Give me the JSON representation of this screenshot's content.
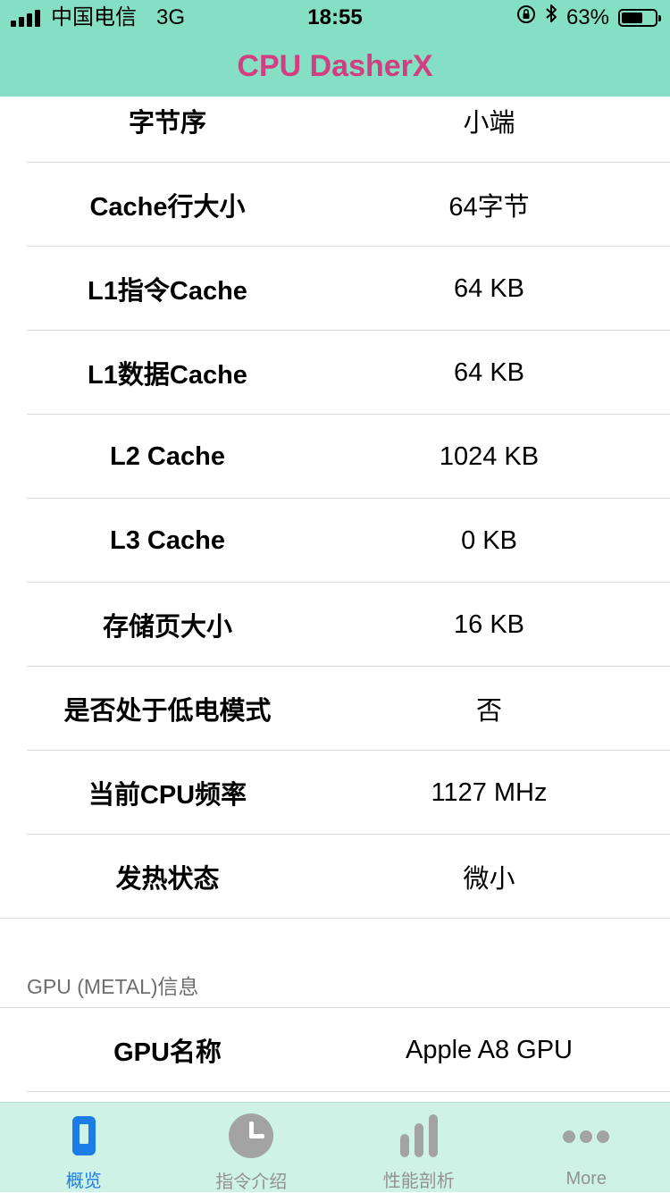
{
  "status_bar": {
    "carrier": "中国电信",
    "network": "3G",
    "time": "18:55",
    "battery_percent": "63%",
    "battery_level": 0.63
  },
  "nav": {
    "title": "CPU DasherX"
  },
  "cpu_rows": [
    {
      "label": "字节序",
      "value": "小端"
    },
    {
      "label": "Cache行大小",
      "value": "64字节"
    },
    {
      "label": "L1指令Cache",
      "value": "64 KB"
    },
    {
      "label": "L1数据Cache",
      "value": "64 KB"
    },
    {
      "label": "L2 Cache",
      "value": "1024 KB"
    },
    {
      "label": "L3 Cache",
      "value": "0 KB"
    },
    {
      "label": "存储页大小",
      "value": "16 KB"
    },
    {
      "label": "是否处于低电模式",
      "value": "否"
    },
    {
      "label": "当前CPU频率",
      "value": "1127 MHz"
    },
    {
      "label": "发热状态",
      "value": "微小"
    }
  ],
  "gpu_section": {
    "header": "GPU (METAL)信息",
    "rows": [
      {
        "label": "GPU名称",
        "value": "Apple A8 GPU"
      }
    ]
  },
  "tabbar": {
    "tabs": [
      {
        "label": "概览",
        "icon": "phone-icon",
        "active": true
      },
      {
        "label": "指令介绍",
        "icon": "clock-icon",
        "active": false
      },
      {
        "label": "性能剖析",
        "icon": "bar-chart-icon",
        "active": false
      },
      {
        "label": "More",
        "icon": "more-icon",
        "active": false
      }
    ],
    "active_color": "#1a7de8",
    "inactive_color": "#929292"
  },
  "colors": {
    "header_bg": "#84dfc4",
    "title": "#d23e7f",
    "tabbar_bg": "#cff2e7"
  }
}
